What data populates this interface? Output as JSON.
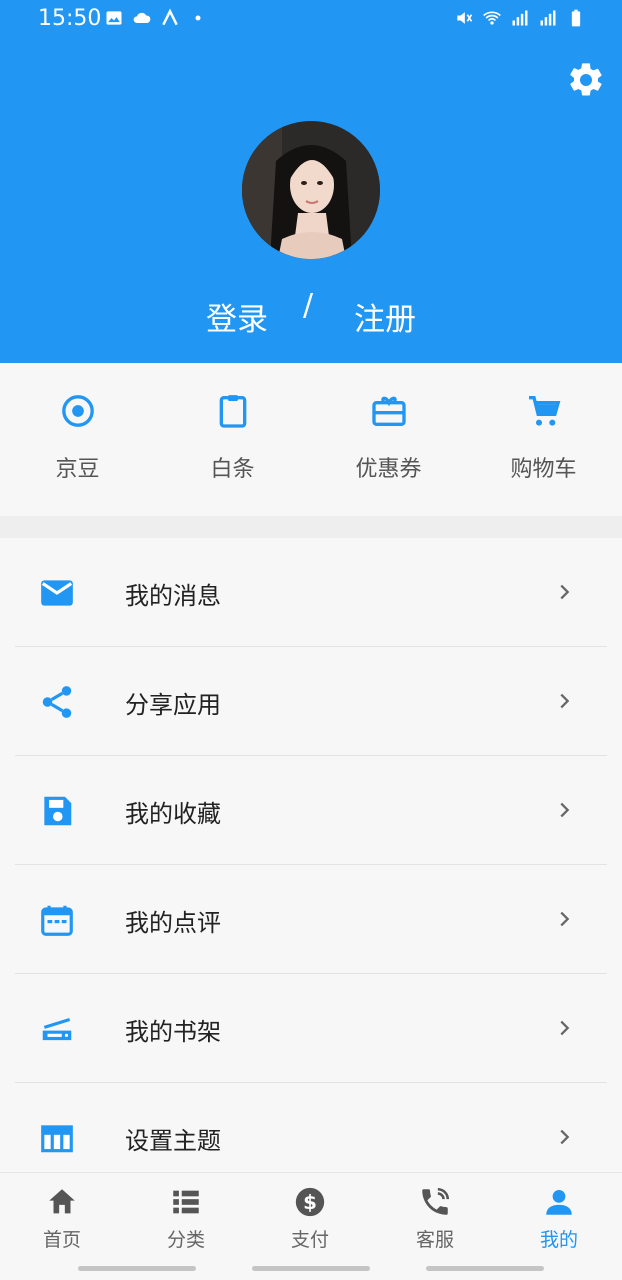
{
  "status_bar": {
    "time": "15:50",
    "left_icons": [
      "image-icon",
      "cloud-icon",
      "gesture-icon",
      "dot-icon"
    ],
    "right_icons": [
      "mute-icon",
      "wifi-icon",
      "signal-icon",
      "signal-icon",
      "battery-icon"
    ]
  },
  "header": {
    "background_color": "#2196F3",
    "settings_icon": "gear-icon",
    "avatar": "avatar",
    "login_label": "登录",
    "separator": "/",
    "register_label": "注册"
  },
  "quick_actions": [
    {
      "label": "京豆",
      "icon": "target-icon"
    },
    {
      "label": "白条",
      "icon": "clipboard-icon"
    },
    {
      "label": "优惠券",
      "icon": "gift-card-icon"
    },
    {
      "label": "购物车",
      "icon": "cart-icon"
    }
  ],
  "menu": [
    {
      "label": "我的消息",
      "icon": "mail-icon"
    },
    {
      "label": "分享应用",
      "icon": "share-icon"
    },
    {
      "label": "我的收藏",
      "icon": "save-icon"
    },
    {
      "label": "我的点评",
      "icon": "calendar-icon"
    },
    {
      "label": "我的书架",
      "icon": "scanner-icon"
    },
    {
      "label": "设置主题",
      "icon": "table-icon"
    }
  ],
  "bottom_nav": [
    {
      "label": "首页",
      "icon": "home-icon",
      "active": false
    },
    {
      "label": "分类",
      "icon": "list-icon",
      "active": false
    },
    {
      "label": "支付",
      "icon": "dollar-icon",
      "active": false
    },
    {
      "label": "客服",
      "icon": "phone-icon",
      "active": false
    },
    {
      "label": "我的",
      "icon": "person-icon",
      "active": true
    }
  ],
  "colors": {
    "accent": "#2196F3",
    "text": "#222222",
    "muted": "#666666"
  }
}
